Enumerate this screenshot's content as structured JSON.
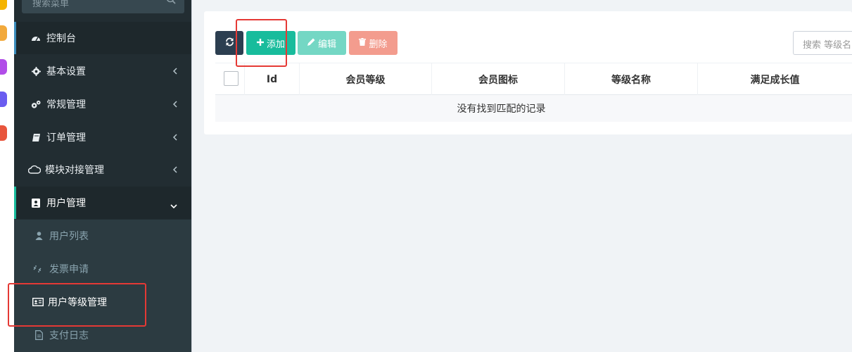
{
  "colors": {
    "sidebar_bg": "#222d32",
    "submenu_bg": "#2c3b41",
    "accent": "#18bc9c",
    "refresh_btn": "#2c3e50",
    "delete_btn": "#f39c8e",
    "highlight": "#e53935"
  },
  "sidebar": {
    "search_placeholder": "搜索菜单",
    "items": [
      {
        "label": "控制台",
        "icon": "dashboard-icon"
      },
      {
        "label": "基本设置",
        "icon": "gear-icon"
      },
      {
        "label": "常规管理",
        "icon": "gears-icon"
      },
      {
        "label": "订单管理",
        "icon": "book-icon"
      },
      {
        "label": "模块对接管理",
        "icon": "cloud-icon"
      },
      {
        "label": "用户管理",
        "icon": "user-box-icon"
      }
    ],
    "sub_items": [
      {
        "label": "用户列表",
        "icon": "user-icon"
      },
      {
        "label": "发票申请",
        "icon": "chain-broken-icon"
      },
      {
        "label": "用户等级管理",
        "icon": "id-card-icon"
      },
      {
        "label": "支付日志",
        "icon": "file-icon"
      }
    ]
  },
  "toolbar": {
    "add_label": "添加",
    "edit_label": "编辑",
    "delete_label": "删除",
    "search_placeholder": "搜索 等级名"
  },
  "table": {
    "columns": [
      "Id",
      "会员等级",
      "会员图标",
      "等级名称",
      "满足成长值"
    ],
    "empty_text": "没有找到匹配的记录"
  }
}
